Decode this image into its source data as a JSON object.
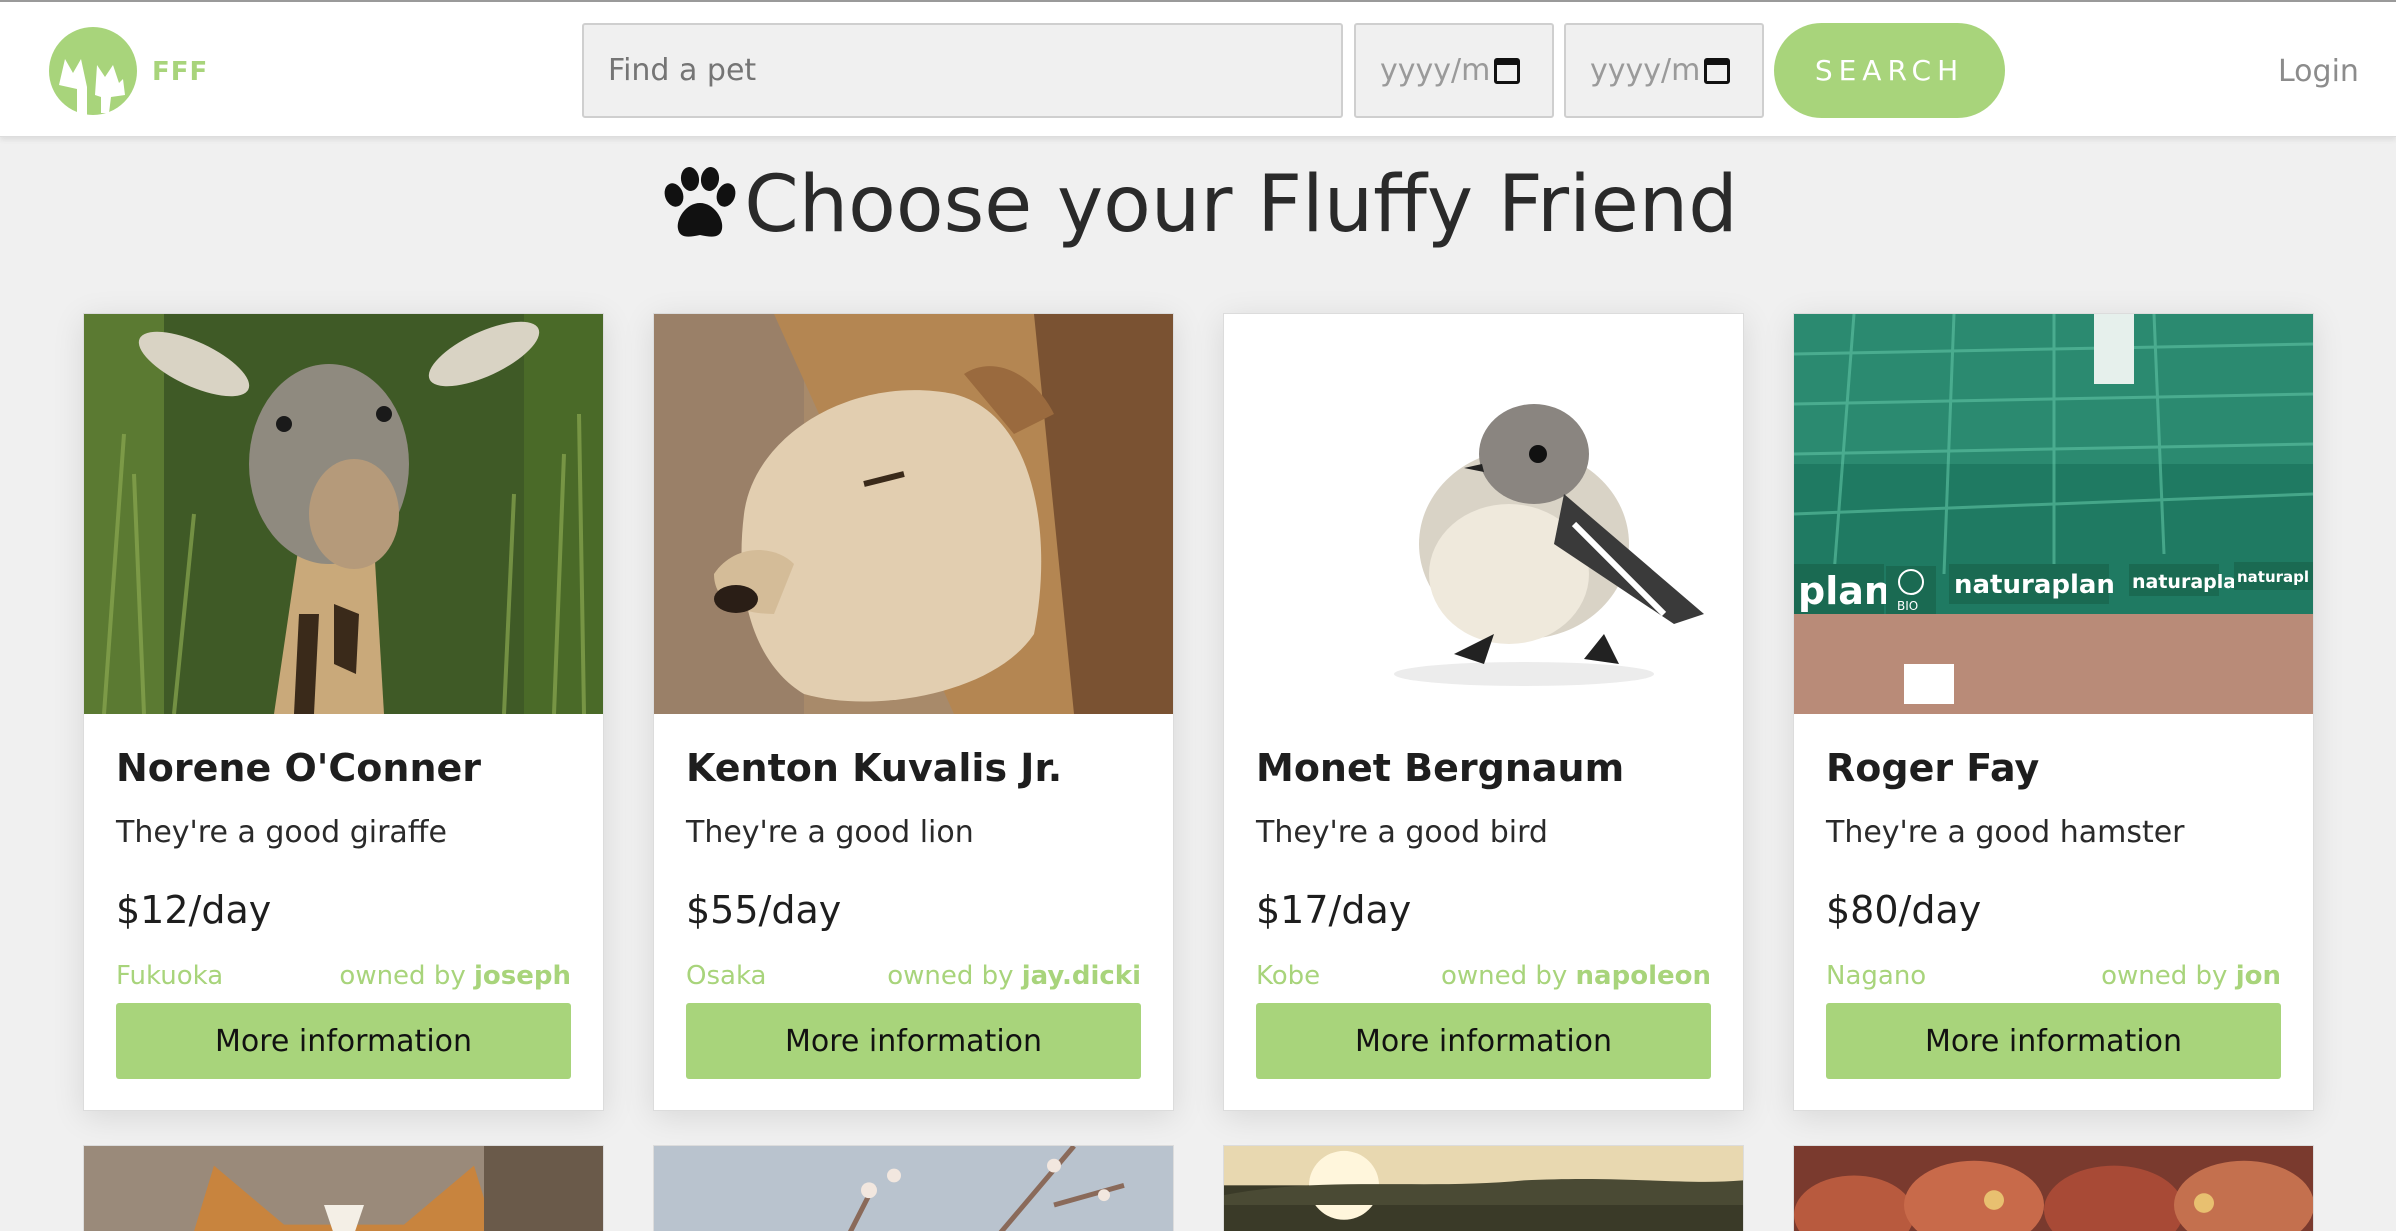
{
  "header": {
    "brand": "FFF",
    "search_placeholder": "Find a pet",
    "date_placeholder_start": "yyyy/m",
    "date_placeholder_end": "yyyy/m",
    "search_label": "SEARCH",
    "login_label": "Login"
  },
  "main": {
    "title": "Choose your Fluffy Friend",
    "pets": [
      {
        "name": "Norene O'Conner",
        "description": "They're a good giraffe",
        "price": "$12/day",
        "city": "Fukuoka",
        "owner_prefix": "owned by",
        "owner": "joseph",
        "button": "More information",
        "image": "giraffe"
      },
      {
        "name": "Kenton Kuvalis Jr.",
        "description": "They're a good lion",
        "price": "$55/day",
        "city": "Osaka",
        "owner_prefix": "owned by",
        "owner": "jay.dicki",
        "button": "More information",
        "image": "lion"
      },
      {
        "name": "Monet Bergnaum",
        "description": "They're a good bird",
        "price": "$17/day",
        "city": "Kobe",
        "owner_prefix": "owned by",
        "owner": "napoleon",
        "button": "More information",
        "image": "bird"
      },
      {
        "name": "Roger Fay",
        "description": "They're a good hamster",
        "price": "$80/day",
        "city": "Nagano",
        "owner_prefix": "owned by",
        "owner": "jon",
        "button": "More information",
        "image": "market-crates"
      }
    ],
    "photo_text": {
      "plan": "plan",
      "bio": "BIO",
      "naturaplan_1": "naturaplan",
      "naturaplan_2": "naturaplan",
      "naturaplan_3": "naturapl"
    }
  },
  "colors": {
    "accent": "#a8d47b",
    "background": "#f0f0f0"
  },
  "icons": [
    "cat-logo-icon",
    "paw-icon",
    "calendar-icon"
  ]
}
